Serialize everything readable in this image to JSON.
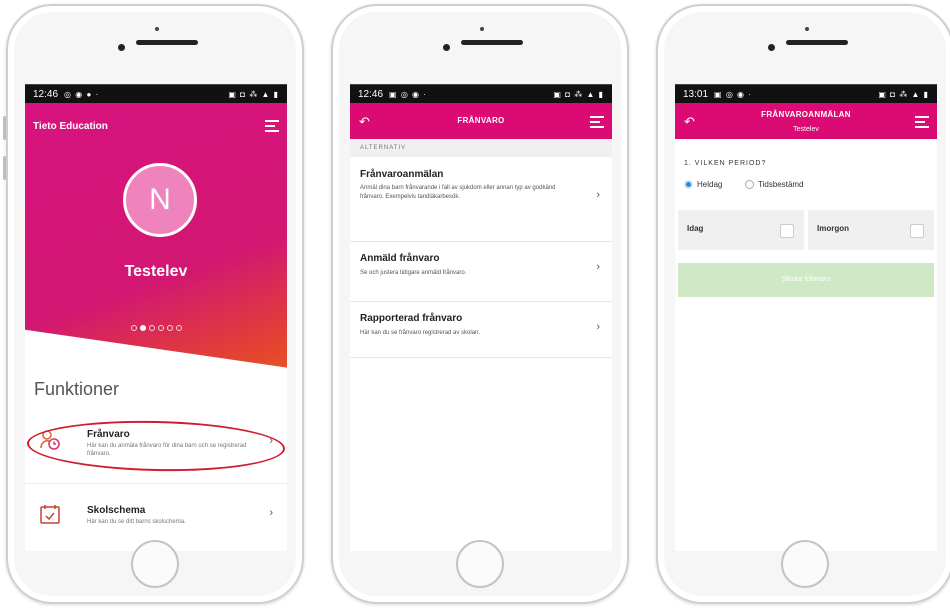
{
  "phone1": {
    "status_time": "12:46",
    "status_left_icons": "◎ ◉ ● ·",
    "status_right_icons": "▣ ◘ ⁂ ▲ ▮",
    "brand": "Tieto Education",
    "avatar_initial": "N",
    "username": "Testelev",
    "pager_total": 6,
    "pager_active": 2,
    "section_title": "Funktioner",
    "items": [
      {
        "title": "Frånvaro",
        "subtitle": "Här kan du anmäla frånvaro för dina barn och se registrerad frånvaro.",
        "chevron": "›",
        "icon": "person-clock-icon"
      },
      {
        "title": "Skolschema",
        "subtitle": "Här kan du se ditt barns skolschema.",
        "chevron": "›",
        "icon": "calendar-check-icon"
      }
    ],
    "colors": {
      "gradient_start": "#d8127f",
      "gradient_end": "#ee6a17",
      "highlight": "#d11e2d"
    }
  },
  "phone2": {
    "status_time": "12:46",
    "status_left_icons": "▣ ◎ ◉ ·",
    "status_right_icons": "▣ ◘ ⁂ ▲ ▮",
    "back_glyph": "↶",
    "title": "FRÅNVARO",
    "group_header": "ALTERNATIV",
    "items": [
      {
        "title": "Frånvaroanmälan",
        "subtitle": "Anmäl dina barn frånvarande i fall av sjukdom eller annan typ av godkänd frånvaro. Exempelvis tandläkarbesök.",
        "chevron": "›"
      },
      {
        "title": "Anmäld frånvaro",
        "subtitle": "Se och justera tidigare anmäld frånvaro.",
        "chevron": "›"
      },
      {
        "title": "Rapporterad frånvaro",
        "subtitle": "Här kan du se frånvaro registrerad av skolan.",
        "chevron": "›"
      }
    ],
    "colors": {
      "appbar": "#dc0a73"
    }
  },
  "phone3": {
    "status_time": "13:01",
    "status_left_icons": "▣ ◎ ◉ ·",
    "status_right_icons": "▣ ◘ ⁂ ▲ ▮",
    "back_glyph": "↶",
    "title": "FRÅNVAROANMÄLAN",
    "subtitle": "Testelev",
    "question": "1. VILKEN PERIOD?",
    "radio_options": [
      {
        "label": "Heldag",
        "selected": true
      },
      {
        "label": "Tidsbestämd",
        "selected": false
      }
    ],
    "day_options": [
      {
        "label": "Idag",
        "checked": false
      },
      {
        "label": "Imorgon",
        "checked": false
      }
    ],
    "submit_label": "Skicka frånvaro",
    "colors": {
      "submit_disabled": "#cfe9c7",
      "radio_selected": "#2a86d6"
    }
  }
}
